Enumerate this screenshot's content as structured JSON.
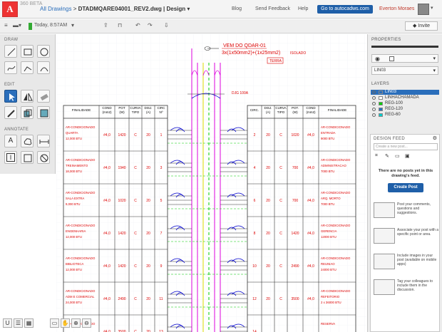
{
  "header": {
    "logo_text": "360 BETA",
    "breadcrumb_link": "All Drawings",
    "breadcrumb_sep": ">",
    "file_name": "DTADMQARE04001_REV2.dwg | Design",
    "nav": [
      "Blog",
      "Send Feedback",
      "Help"
    ],
    "go_button": "Go to autocadws.com",
    "user_name": "Everton Moraes"
  },
  "toolbar": {
    "timestamp": "Today, 8:57AM",
    "invite_label": "Invite"
  },
  "left_panel": {
    "draw_label": "DRAW",
    "edit_label": "EDIT",
    "annotate_label": "ANNOTATE"
  },
  "properties": {
    "label": "PROPERTIES",
    "layer_value": "LIN03"
  },
  "layers": {
    "label": "LAYERS",
    "items": [
      {
        "name": "LIN03",
        "color": "#2a6ebb",
        "selected": true
      },
      {
        "name": "LINHACHAMADA",
        "color": "#ffffff",
        "selected": false
      },
      {
        "name": "REG-100",
        "color": "#00cc00",
        "selected": false
      },
      {
        "name": "REG-120",
        "color": "#2a6ebb",
        "selected": false
      },
      {
        "name": "REG-60",
        "color": "#00cccc",
        "selected": false
      }
    ]
  },
  "feed": {
    "label": "DESIGN FEED",
    "new_post_placeholder": "Create a new post...",
    "empty_message": "There are no posts yet in this drawing's feed.",
    "create_button": "Create Post",
    "tips": [
      "Post your comments, questions and suggestions.",
      "Associate your post with a specific point or area.",
      "Include images in your post (available on mobile apps)",
      "Tag your colleagues to include them in the discussion."
    ]
  },
  "drawing": {
    "title1": "VEM DO QDAR-01",
    "title2": "3x(1x50mm2)+(1x25mm2)",
    "isolado": "ISOLADO",
    "terra": "TERRA",
    "dj": "DJG 100A",
    "left_headers": [
      "FINALIDADE",
      "COND (mm2)",
      "POT (W)",
      "CURVA TIPO",
      "DISJ. (A)",
      "CIRC Nº"
    ],
    "right_headers": [
      "CIRC.",
      "DISJ. (A)",
      "CURVA TIPO",
      "POT. (W)",
      "COND (mm2)",
      "FINALIDADE"
    ],
    "rows": [
      {
        "lf": [
          "AR-CONDICIONADO",
          "QUARTA",
          "12,000 BTU"
        ],
        "lc": "#4,0",
        "lp": "1420",
        "lcv": "C",
        "ld": "20",
        "ln": "1",
        "rn": "2",
        "rd": "20",
        "rcv": "C",
        "rp": "1020",
        "rc": "#4,0",
        "rf": [
          "AR-CONDICIONADO",
          "ENTRADA",
          "9000 BTU"
        ]
      },
      {
        "lf": [
          "AR-CONDICIONADO",
          "TREINAMENTO",
          "18,000 BTU"
        ],
        "lc": "#4,0",
        "lp": "1940",
        "lcv": "C",
        "ld": "20",
        "ln": "3",
        "rn": "4",
        "rd": "20",
        "rcv": "C",
        "rp": "700",
        "rc": "#4,0",
        "rf": [
          "AR-CONDICIONADO",
          "ADMINISTRACAO",
          "7000 BTU"
        ]
      },
      {
        "lf": [
          "AR-CONDICIONADO",
          "SALA EXTRA",
          "9,000 BTU"
        ],
        "lc": "#4,0",
        "lp": "1020",
        "lcv": "C",
        "ld": "20",
        "ln": "5",
        "rn": "6",
        "rd": "20",
        "rcv": "C",
        "rp": "700",
        "rc": "#4,0",
        "rf": [
          "AR-CONDICIONADO",
          "ARQ. MORTO",
          "7000 BTU"
        ]
      },
      {
        "lf": [
          "AR-CONDICIONADO",
          "ENGENHARIA",
          "12,000 BTU"
        ],
        "lc": "#4,0",
        "lp": "1420",
        "lcv": "C",
        "ld": "20",
        "ln": "7",
        "rn": "8",
        "rd": "20",
        "rcv": "C",
        "rp": "1420",
        "rc": "#4,0",
        "rf": [
          "AR-CONDICIONADO",
          "GERENCIA",
          "12000 BTU"
        ]
      },
      {
        "lf": [
          "AR-CONDICIONADO",
          "BIBLIOTECA",
          "12,000 BTU"
        ],
        "lc": "#4,0",
        "lp": "1420",
        "lcv": "C",
        "ld": "20",
        "ln": "9",
        "rn": "10",
        "rd": "20",
        "rcv": "C",
        "rp": "2490",
        "rc": "#4,0",
        "rf": [
          "AR-CONDICIONADO",
          "REUNIAO",
          "24000 BTU"
        ]
      },
      {
        "lf": [
          "AR-CONDICIONADO",
          "ADM E COMERCIAL",
          "24,000 BTU"
        ],
        "lc": "#4,0",
        "lp": "2490",
        "lcv": "C",
        "ld": "20",
        "ln": "11",
        "rn": "12",
        "rd": "20",
        "rcv": "C",
        "rp": "3500",
        "rc": "#4,0",
        "rf": [
          "AR-CONDICIONADO",
          "REFEITORIO",
          "2 x 36000 BTU"
        ]
      },
      {
        "lf": [
          "AR-CONDICIONADO",
          "",
          ""
        ],
        "lc": "#4,0",
        "lp": "3500",
        "lcv": "C",
        "ld": "20",
        "ln": "13",
        "rn": "14",
        "rd": "",
        "rcv": "",
        "rp": "",
        "rc": "",
        "rf": [
          "RESERVA",
          "",
          ""
        ]
      }
    ]
  }
}
